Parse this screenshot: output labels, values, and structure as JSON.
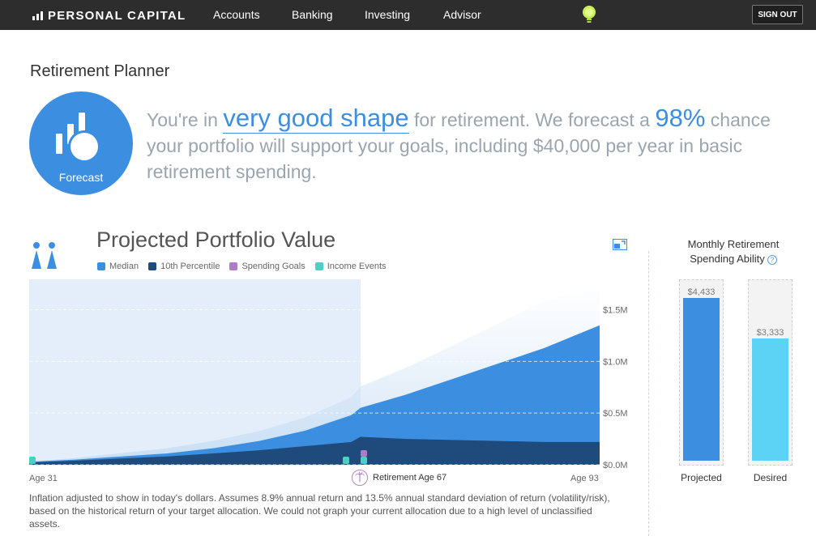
{
  "nav": {
    "brand": "PERSONAL CAPITAL",
    "links": [
      "Accounts",
      "Banking",
      "Investing",
      "Advisor"
    ],
    "signout": "SIGN OUT"
  },
  "page_title": "Retirement Planner",
  "forecast_label": "Forecast",
  "summary": {
    "part1": "You're in ",
    "emphasis_shape": "very good shape",
    "part2": " for retirement. We forecast a ",
    "emphasis_percent": "98%",
    "part3": " chance your portfolio will support your goals, including $40,000 per year in basic retirement spending."
  },
  "chart_title": "Projected Portfolio Value",
  "colors": {
    "median": "#3c8fe0",
    "percentile10": "#1f4a7c",
    "spending_goals": "#b07cc6",
    "income_events": "#4ccfc4",
    "desired": "#5cd2f5",
    "header_bg": "#2d2d2d"
  },
  "legend": [
    {
      "label": "Median",
      "color": "#3c8fe0"
    },
    {
      "label": "10th Percentile",
      "color": "#1f4a7c"
    },
    {
      "label": "Spending Goals",
      "color": "#b07cc6"
    },
    {
      "label": "Income Events",
      "color": "#4ccfc4"
    }
  ],
  "chart_data": {
    "type": "area",
    "title": "Projected Portfolio Value",
    "x_label_left": "Age 31",
    "x_label_right": "Age 93",
    "retirement_label": "Retirement Age 67",
    "x": [
      31,
      36,
      41,
      46,
      51,
      56,
      61,
      66,
      67,
      72,
      77,
      82,
      87,
      93
    ],
    "series": [
      {
        "name": "Median",
        "values": [
          0.03,
          0.05,
          0.08,
          0.11,
          0.16,
          0.23,
          0.33,
          0.48,
          0.55,
          0.68,
          0.83,
          0.98,
          1.13,
          1.35
        ]
      },
      {
        "name": "10th Percentile",
        "values": [
          0.02,
          0.04,
          0.06,
          0.08,
          0.11,
          0.14,
          0.18,
          0.22,
          0.27,
          0.25,
          0.24,
          0.23,
          0.22,
          0.22
        ]
      }
    ],
    "y_ticks": [
      "$0.0M",
      "$0.5M",
      "$1.0M",
      "$1.5M"
    ],
    "ylim": [
      0,
      1.7
    ],
    "ylabel_unit": "$M"
  },
  "footnote": "Inflation adjusted to show in today's dollars. Assumes 8.9% annual return and 13.5% annual standard deviation of return (volatility/risk), based on the historical return of your target allocation. We could not graph your current allocation due to a high level of unclassified assets.",
  "spending": {
    "title": "Monthly Retirement Spending Ability",
    "help_glyph": "?",
    "max": 4800,
    "bars": [
      {
        "caption": "Projected",
        "value_label": "$4,433",
        "value": 4433,
        "color": "#3c8fe0"
      },
      {
        "caption": "Desired",
        "value_label": "$3,333",
        "value": 3333,
        "color": "#5cd2f5"
      }
    ]
  }
}
